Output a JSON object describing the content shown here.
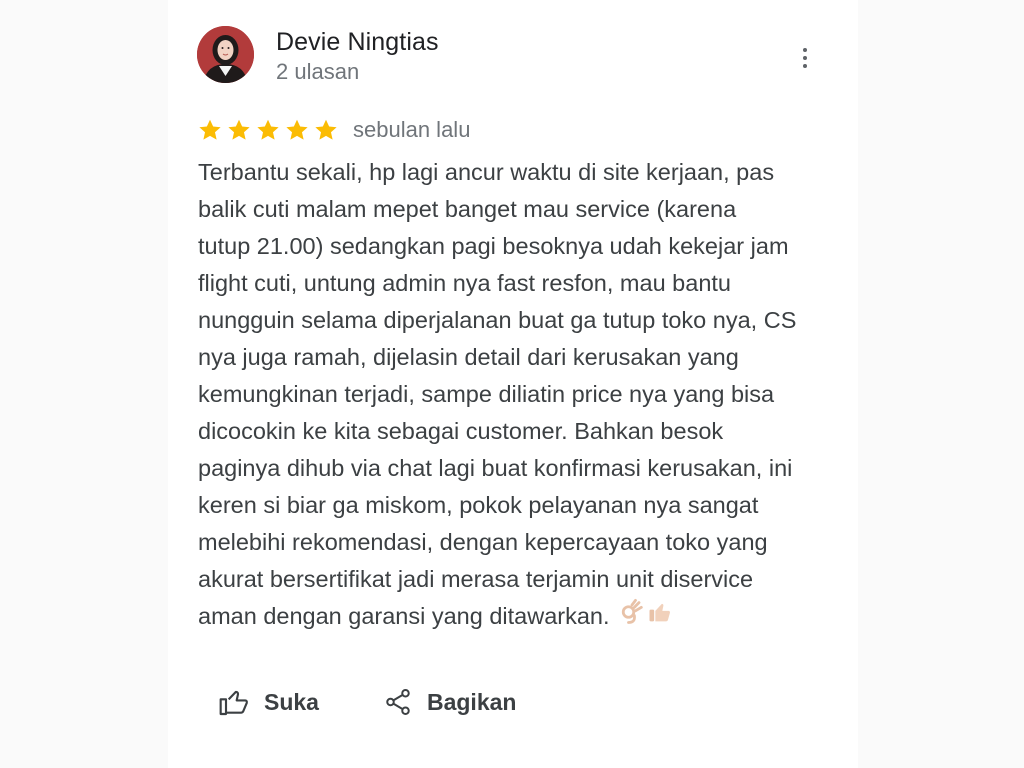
{
  "review": {
    "author_name": "Devie Ningtias",
    "author_subtitle": "2 ulasan",
    "rating": 5,
    "max_rating": 5,
    "time_ago": "sebulan lalu",
    "text_lines": [
      "Terbantu sekali, hp lagi ancur waktu di site kerjaan, pas",
      "balik cuti malam mepet banget mau service (karena",
      "tutup 21.00) sedangkan pagi besoknya udah kekejar jam",
      "flight cuti, untung admin nya fast resfon, mau bantu",
      "nungguin selama diperjalanan buat ga tutup toko nya, CS",
      "nya juga ramah, dijelasin detail dari kerusakan yang",
      "kemungkinan terjadi, sampe diliatin price nya yang bisa",
      "dicocokin ke kita sebagai customer. Bahkan besok",
      "paginya dihub via chat lagi buat konfirmasi kerusakan, ini",
      "keren si biar ga miskom, pokok pelayanan nya sangat",
      "melebihi rekomendasi, dengan kepercayaan toko yang",
      "akurat bersertifikat jadi merasa terjamin unit diservice",
      "aman dengan garansi yang ditawarkan."
    ],
    "emojis": [
      "ok-hand-icon",
      "thumbs-up-icon"
    ]
  },
  "actions": {
    "like_label": "Suka",
    "share_label": "Bagikan"
  },
  "icons": {
    "more": "more-vertical-icon",
    "like": "thumbs-up-outline-icon",
    "share": "share-icon",
    "star": "star-icon"
  },
  "colors": {
    "star": "#fbbc04",
    "text": "#3c4043",
    "secondary_text": "#70757a",
    "avatar_bg": "#b23b3b"
  }
}
